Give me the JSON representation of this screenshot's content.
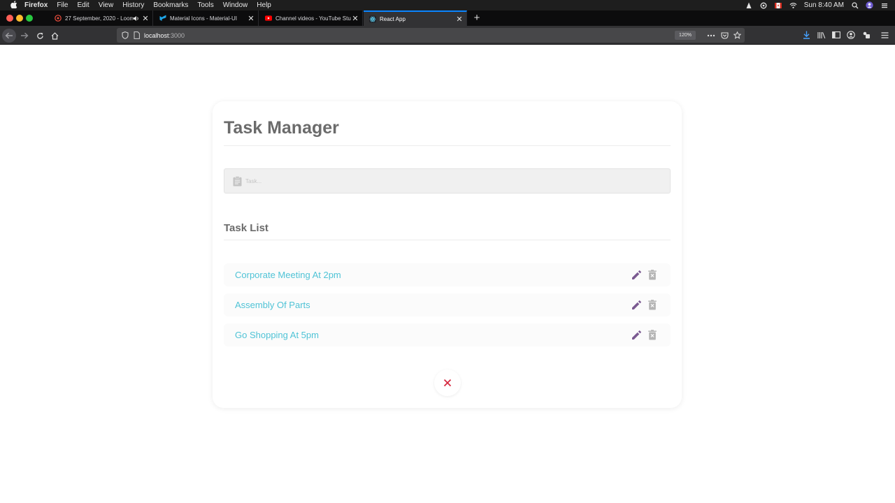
{
  "menubar": {
    "app": "Firefox",
    "items": [
      "File",
      "Edit",
      "View",
      "History",
      "Bookmarks",
      "Tools",
      "Window",
      "Help"
    ],
    "clock": "Sun 8:40 AM"
  },
  "tabs": [
    {
      "title": "27 September, 2020 - Loom",
      "icon": "loom-icon"
    },
    {
      "title": "Material Icons - Material-UI",
      "icon": "material-ui-icon"
    },
    {
      "title": "Channel videos - YouTube Studio",
      "icon": "youtube-icon"
    },
    {
      "title": "React App",
      "icon": "react-icon"
    }
  ],
  "navbar": {
    "host": "localhost",
    "port": ":3000",
    "zoom": "120%"
  },
  "app": {
    "title": "Task Manager",
    "task_placeholder": "Task...",
    "list_heading": "Task List",
    "tasks": [
      {
        "text": "Corporate Meeting At 2pm"
      },
      {
        "text": "Assembly Of Parts"
      },
      {
        "text": "Go Shopping At 5pm"
      }
    ]
  },
  "colors": {
    "accent_task_text": "#4fc3d6",
    "edit_icon": "#7b5a91",
    "delete_icon": "#b4b4b4",
    "clear_icon": "#d6283f",
    "tab_active_border": "#0a84ff"
  }
}
